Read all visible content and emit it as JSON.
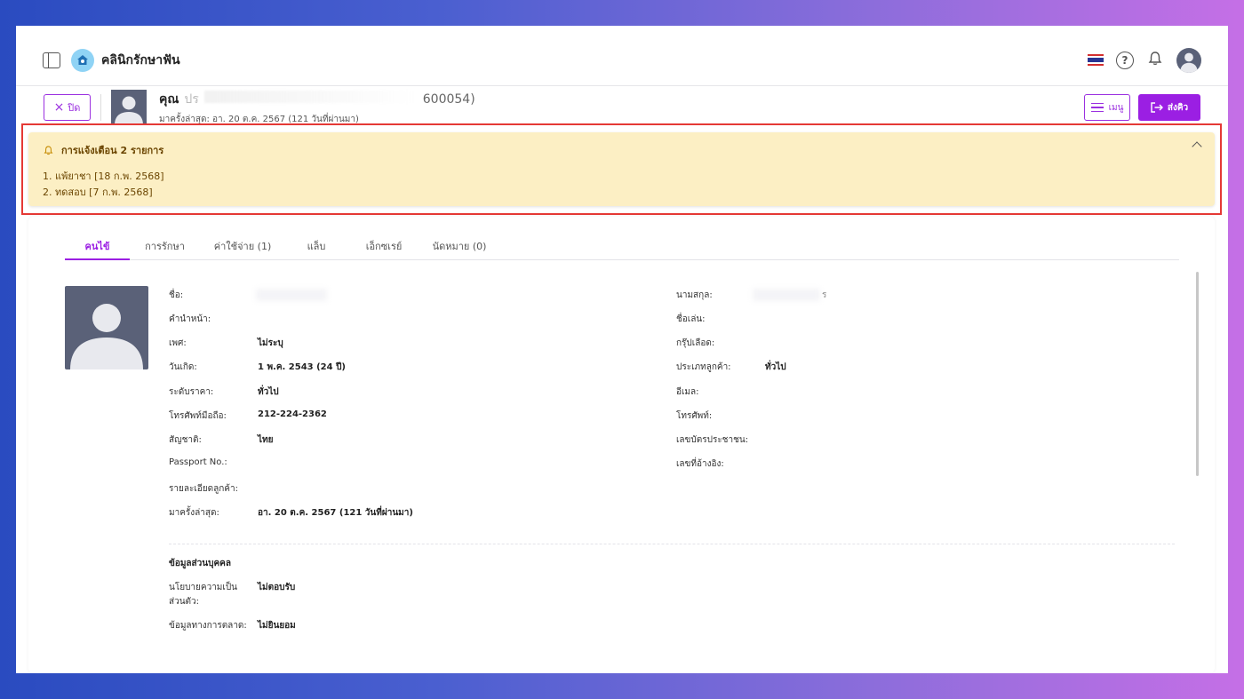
{
  "app": {
    "title": "คลินิกรักษาฟัน"
  },
  "topbar": {
    "help_glyph": "?"
  },
  "patient": {
    "prefix": "คุณ",
    "name_visible_start": "ปร",
    "id_suffix": "600054)",
    "last_visit": "มาครั้งล่าสุด: อา. 20 ต.ค. 2567 (121 วันที่ผ่านมา)"
  },
  "buttons": {
    "close": "ปิด",
    "menu": "เมนู",
    "send": "ส่งคิว"
  },
  "alert": {
    "title": "การแจ้งเตือน 2 รายการ",
    "items": [
      "1. แพ้ยาชา [18 ก.พ. 2568]",
      "2. ทดสอบ [7 ก.พ. 2568]"
    ]
  },
  "tabs": [
    "คนไข้",
    "การรักษา",
    "ค่าใช้จ่าย (1)",
    "แล็บ",
    "เอ็กซเรย์",
    "นัดหมาย (0)"
  ],
  "left_fields": [
    {
      "label": "ชื่อ:",
      "value": ""
    },
    {
      "label": "คำนำหน้า:",
      "value": ""
    },
    {
      "label": "เพศ:",
      "value": "ไม่ระบุ"
    },
    {
      "label": "วันเกิด:",
      "value": "1 พ.ค. 2543 (24 ปี)"
    },
    {
      "label": "ระดับราคา:",
      "value": "ทั่วไป"
    },
    {
      "label": "โทรศัพท์มือถือ:",
      "value": "212-224-2362"
    },
    {
      "label": "สัญชาติ:",
      "value": "ไทย"
    },
    {
      "label": "Passport No.:",
      "value": ""
    },
    {
      "label": "รายละเอียดลูกค้า:",
      "value": ""
    },
    {
      "label": "มาครั้งล่าสุด:",
      "value": "อา. 20 ต.ค. 2567 (121 วันที่ผ่านมา)"
    }
  ],
  "right_fields": [
    {
      "label": "นามสกุล:",
      "value": "ร"
    },
    {
      "label": "ชื่อเล่น:",
      "value": ""
    },
    {
      "label": "กรุ๊ปเลือด:",
      "value": ""
    },
    {
      "label": "ประเภทลูกค้า:",
      "value": "ทั่วไป"
    },
    {
      "label": "อีเมล:",
      "value": ""
    },
    {
      "label": "โทรศัพท์:",
      "value": ""
    },
    {
      "label": "เลขบัตรประชาชน:",
      "value": ""
    },
    {
      "label": "เลขที่อ้างอิง:",
      "value": ""
    }
  ],
  "privacy": {
    "section_title": "ข้อมูลส่วนบุคคล",
    "policy_label_line1": "นโยบายความเป็น",
    "policy_label_line2": "ส่วนตัว:",
    "policy_value": "ไม่ตอบรับ",
    "marketing_label": "ข้อมูลทางการตลาด:",
    "marketing_value": "ไม่ยินยอม"
  },
  "colors": {
    "accent": "#9b1fe3",
    "alert_bg": "#fcefc4",
    "alert_text": "#6b4500",
    "highlight": "#e53935",
    "avatar_bg": "#5a6178"
  }
}
